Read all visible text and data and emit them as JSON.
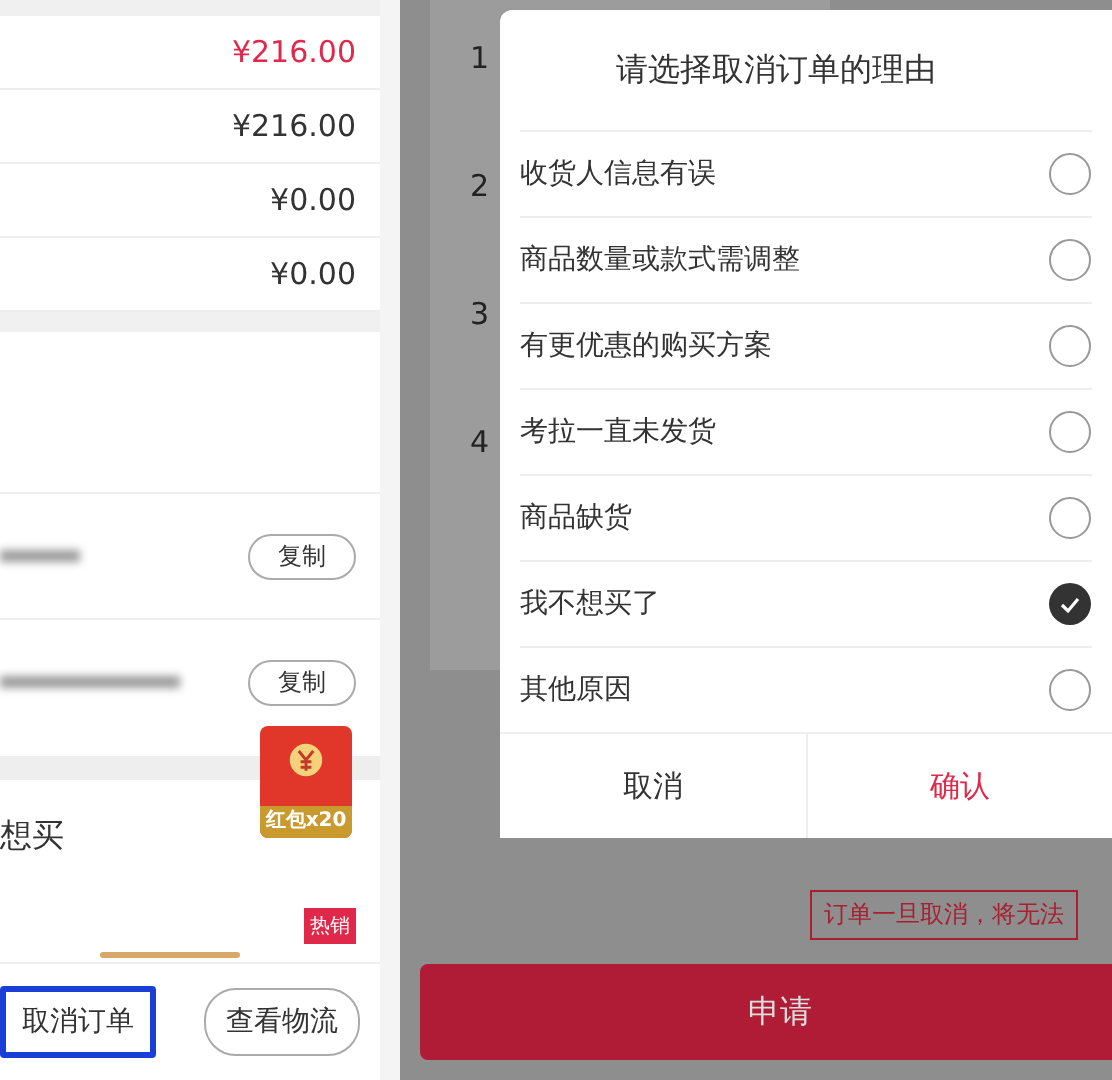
{
  "left_screen": {
    "price_rows": [
      {
        "value": "¥216.00",
        "highlight": true
      },
      {
        "value": "¥216.00",
        "highlight": false
      },
      {
        "value": "¥0.00",
        "highlight": false
      },
      {
        "value": "¥0.00",
        "highlight": false
      }
    ],
    "copy_rows": [
      {
        "button": "复制"
      },
      {
        "button": "复制"
      }
    ],
    "red_packet": {
      "label": "红包x20"
    },
    "snippet": "想买",
    "hot_badge": "热销",
    "actions": [
      {
        "label": "取消订单",
        "highlighted": true
      },
      {
        "label": "查看物流",
        "highlighted": false
      }
    ]
  },
  "right_screen": {
    "background_numbers": [
      "1",
      "2",
      "3",
      "4"
    ],
    "dialog": {
      "title": "请选择取消订单的理由",
      "reasons": [
        {
          "label": "收货人信息有误",
          "selected": false
        },
        {
          "label": "商品数量或款式需调整",
          "selected": false
        },
        {
          "label": "有更优惠的购买方案",
          "selected": false
        },
        {
          "label": "考拉一直未发货",
          "selected": false
        },
        {
          "label": "商品缺货",
          "selected": false
        },
        {
          "label": "我不想买了",
          "selected": true
        },
        {
          "label": "其他原因",
          "selected": false
        }
      ],
      "buttons": [
        {
          "label": "取消",
          "kind": "cancel"
        },
        {
          "label": "确认",
          "kind": "confirm"
        }
      ]
    },
    "notice": "订单一旦取消，将无法",
    "primary_button": "申请"
  }
}
